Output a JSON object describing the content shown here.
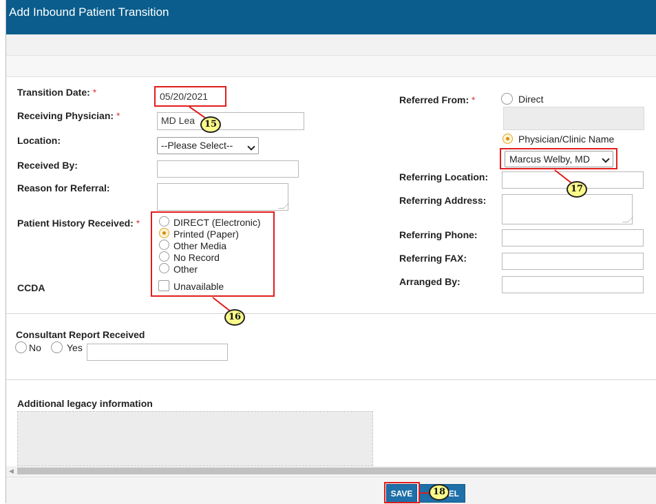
{
  "dialog": {
    "title": "Add Inbound Patient Transition"
  },
  "form": {
    "transition_date_label": "Transition Date:",
    "transition_date_value": "05/20/2021",
    "receiving_physician_label": "Receiving Physician:",
    "receiving_physician_value": "MD  Lea",
    "location_label": "Location:",
    "location_selected": "--Please Select--",
    "received_by_label": "Received By:",
    "reason_label": "Reason for Referral:",
    "history_label": "Patient History Received:",
    "history_options": [
      "DIRECT (Electronic)",
      "Printed (Paper)",
      "Other Media",
      "No Record",
      "Other"
    ],
    "history_selected": "Printed (Paper)",
    "ccda_label": "CCDA",
    "ccda_option": "Unavailable",
    "required_mark": "*"
  },
  "referral": {
    "referred_from_label": "Referred From:",
    "direct_option": "Direct",
    "physician_option": "Physician/Clinic Name",
    "physician_selected": "Marcus Welby, MD",
    "location_label": "Referring Location:",
    "address_label": "Referring Address:",
    "phone_label": "Referring Phone:",
    "fax_label": "Referring FAX:",
    "arranged_label": "Arranged By:"
  },
  "consultant": {
    "label": "Consultant Report Received",
    "no": "No",
    "yes": "Yes"
  },
  "legacy": {
    "label": "Additional legacy information"
  },
  "footer": {
    "save": "SAVE",
    "cancel_visible": "EL"
  },
  "callouts": {
    "c15": "15",
    "c16": "16",
    "c17": "17",
    "c18": "18"
  },
  "colors": {
    "titlebar": "#0a5d8c",
    "accent": "#1f6fa8",
    "annotation": "#e21b1b",
    "callout_fill": "#fbfb8a"
  }
}
